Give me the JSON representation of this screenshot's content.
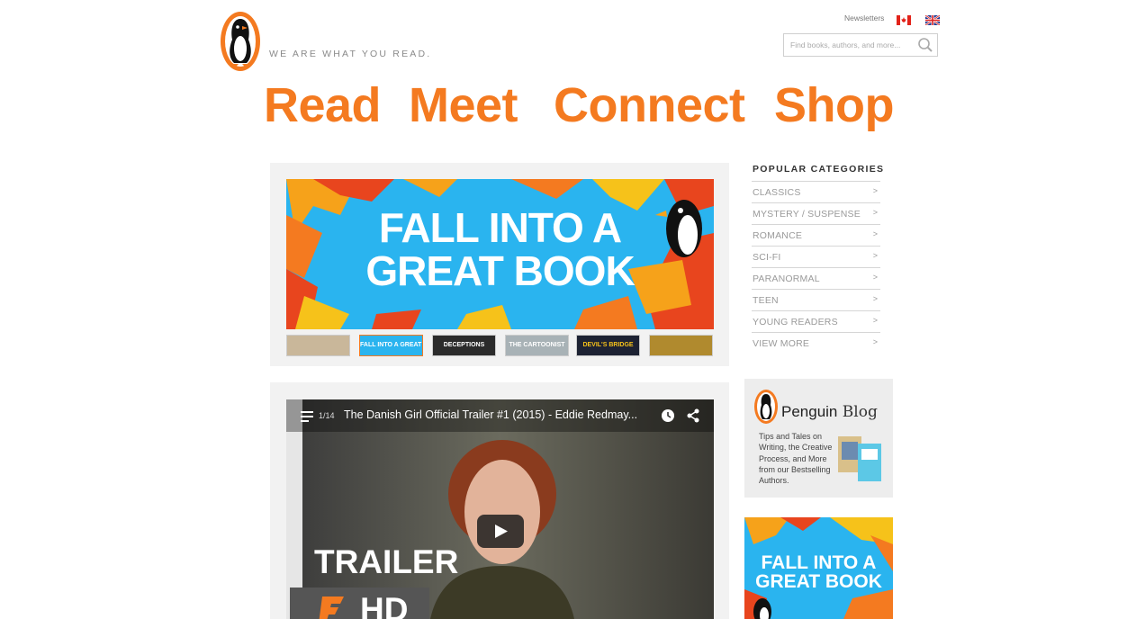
{
  "header": {
    "tagline": "WE ARE WHAT YOU READ.",
    "newsletters": "Newsletters",
    "search_placeholder": "Find books, authors, and more...",
    "flags": [
      "canada-flag-icon",
      "uk-flag-icon"
    ]
  },
  "nav": [
    "Read",
    "Meet",
    "Connect",
    "Shop"
  ],
  "carousel": {
    "hero_line1": "FALL INTO A",
    "hero_line2": "GREAT BOOK",
    "thumbnails": [
      "",
      "FALL INTO A GREAT BOOK",
      "DECEPTIONS",
      "THE CARTOONIST",
      "DEVIL'S BRIDGE",
      ""
    ]
  },
  "categories": {
    "heading": "POPULAR CATEGORIES",
    "items": [
      "CLASSICS",
      "MYSTERY / SUSPENSE",
      "ROMANCE",
      "SCI-FI",
      "PARANORMAL",
      "TEEN",
      "YOUNG READERS",
      "VIEW MORE"
    ],
    "arrow": ">"
  },
  "video": {
    "count": "1/14",
    "title": "The Danish Girl Official Trailer #1 (2015) - Eddie Redmay...",
    "trailer_label": "TRAILER",
    "hd_label": "HD"
  },
  "blog": {
    "brand": "Penguin",
    "title": "Blog",
    "description": "Tips and Tales on Writing, the Creative Process, and More from our Bestselling Authors."
  },
  "promo": {
    "line1": "FALL INTO A",
    "line2": "GREAT BOOK"
  },
  "colors": {
    "brand_orange": "#f47a20",
    "sky_blue": "#2ab4ef"
  }
}
